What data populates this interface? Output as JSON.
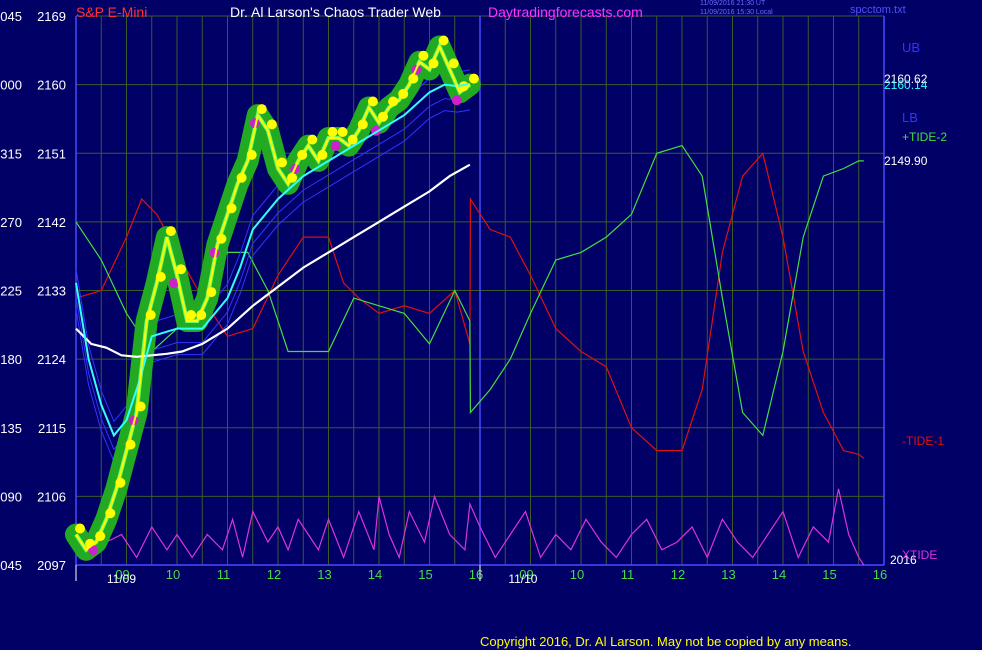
{
  "header": {
    "symbol": "S&P E-Mini",
    "title": "Dr. Al Larson's Chaos Trader Web",
    "site": "Daytradingforecasts.com",
    "stamp_utc": "11/09/2016 21:30 UT",
    "stamp_local": "11/09/2016 15:30 Local",
    "file": "spcctom.txt"
  },
  "copyright": "Copyright 2016, Dr. Al Larson. May not be copied by any means.",
  "colors": {
    "background": "#000066",
    "grid": "#3b5b2b",
    "axis": "#4a4aff",
    "symbol": "#ff3030",
    "title": "#ffffff",
    "site": "#ff33ff",
    "price_yellow": "#ffff00",
    "band_green": "#22aa22",
    "cyan": "#33ffff",
    "white": "#ffffff",
    "tide_red": "#dd1111",
    "tide_green": "#44dd44",
    "xtide": "#dd33dd",
    "blue_band": "#3333ff"
  },
  "chart_data": {
    "type": "line",
    "ylim": [
      2097,
      2169
    ],
    "y_ticks_price": [
      2097,
      2106,
      2115,
      2124,
      2133,
      2142,
      2151,
      2160,
      2169
    ],
    "y_ticks_left": [
      "045",
      "090",
      "135",
      "180",
      "225",
      "270",
      "315",
      "000",
      "045"
    ],
    "x_hour_labels": [
      "09",
      "10",
      "11",
      "12",
      "13",
      "14",
      "15",
      "16",
      "09",
      "10",
      "11",
      "12",
      "13",
      "14",
      "15",
      "16"
    ],
    "x_date_labels": [
      "11/09",
      "11/10"
    ],
    "year_label": "2016",
    "right_labels": {
      "ub": "UB",
      "lb": "LB",
      "price1": "2160.62",
      "price2": "2160.14",
      "tide2": "+TIDE-2",
      "tide2_value": "2149.90",
      "tide1": "-TIDE-1",
      "xtide": "XTIDE"
    },
    "series": [
      {
        "kind": "price",
        "x": [
          0,
          0.2,
          0.4,
          0.6,
          0.8,
          1.0,
          1.2,
          1.4,
          1.6,
          1.8,
          2.0,
          2.2,
          2.4,
          2.6,
          2.8,
          3.0,
          3.2,
          3.4,
          3.6,
          3.8,
          4.0,
          4.2,
          4.4,
          4.6,
          4.8,
          5.0,
          5.2,
          5.4,
          5.6,
          5.8,
          6.0,
          6.2,
          6.4,
          6.6,
          6.8,
          7.0,
          7.2,
          7.4,
          7.6,
          7.8
        ],
        "y": [
          2101,
          2099,
          2100,
          2103,
          2107,
          2112,
          2117,
          2129,
          2134,
          2140,
          2135,
          2129,
          2129,
          2132,
          2139,
          2143,
          2147,
          2150,
          2156,
          2154,
          2149,
          2147,
          2150,
          2152,
          2150,
          2153,
          2153,
          2152,
          2154,
          2157,
          2155,
          2157,
          2158,
          2160,
          2163,
          2162,
          2165,
          2162,
          2159,
          2160
        ]
      },
      {
        "kind": "cyan",
        "x": [
          0,
          0.25,
          0.5,
          0.75,
          1.0,
          1.25,
          1.5,
          2.0,
          2.5,
          3.0,
          3.25,
          3.5,
          4.0,
          4.5,
          5.0,
          5.5,
          6.0,
          6.5,
          7.0,
          7.3,
          7.55,
          7.8
        ],
        "y": [
          2134,
          2124,
          2118,
          2114,
          2116,
          2121,
          2127,
          2128,
          2128,
          2132,
          2136,
          2141,
          2145,
          2148,
          2150,
          2152,
          2154,
          2156,
          2159,
          2160,
          2159.8,
          2160.1
        ]
      },
      {
        "kind": "white",
        "x": [
          0,
          0.3,
          0.6,
          0.9,
          1.2,
          1.5,
          1.8,
          2.1,
          2.5,
          3.0,
          3.5,
          4.0,
          4.5,
          5.0,
          5.5,
          6.0,
          6.5,
          7.0,
          7.4,
          7.8
        ],
        "y": [
          2128,
          2126,
          2125.5,
          2124.5,
          2124.3,
          2124.5,
          2124.7,
          2125,
          2126,
          2128,
          2131,
          2133.5,
          2136,
          2138,
          2140,
          2142,
          2144,
          2146,
          2148,
          2149.5
        ]
      },
      {
        "kind": "tide1_red",
        "x": [
          0,
          0.5,
          1.0,
          1.3,
          1.6,
          2.0,
          2.5,
          3.0,
          3.5,
          4.0,
          4.5,
          5.0,
          5.3,
          5.6,
          6.0,
          6.5,
          7.0,
          7.5,
          7.8,
          7.81,
          8.2,
          8.6,
          9.0,
          9.5,
          10.0,
          10.5,
          11.0,
          11.5,
          12.0,
          12.4,
          12.8,
          13.2,
          13.6,
          14.0,
          14.4,
          14.8,
          15.2,
          15.5,
          15.6
        ],
        "y": [
          2132,
          2133,
          2140,
          2145,
          2143,
          2138,
          2132,
          2127,
          2128,
          2135,
          2140,
          2140,
          2134,
          2132,
          2130,
          2131,
          2130,
          2133,
          2126,
          2145,
          2141,
          2140,
          2135,
          2128,
          2125,
          2123,
          2115,
          2112,
          2112,
          2120,
          2138,
          2148,
          2151,
          2140,
          2125,
          2117,
          2112,
          2111.5,
          2111
        ]
      },
      {
        "kind": "tide2_green",
        "x": [
          0,
          0.5,
          1.0,
          1.5,
          2.0,
          2.5,
          3.0,
          3.4,
          3.8,
          4.2,
          4.6,
          5.0,
          5.5,
          6.0,
          6.5,
          7.0,
          7.5,
          7.8,
          7.81,
          8.2,
          8.6,
          9.0,
          9.5,
          10.0,
          10.5,
          11.0,
          11.5,
          12.0,
          12.4,
          12.8,
          13.2,
          13.6,
          14.0,
          14.4,
          14.8,
          15.2,
          15.5,
          15.6
        ],
        "y": [
          2142,
          2137,
          2130,
          2125,
          2128,
          2133,
          2138,
          2138,
          2133,
          2125,
          2125,
          2125,
          2132,
          2131,
          2130,
          2126,
          2133,
          2129,
          2117,
          2120,
          2124,
          2130,
          2137,
          2138,
          2140,
          2143,
          2151,
          2152,
          2148,
          2132,
          2117,
          2114,
          2125,
          2140,
          2148,
          2149,
          2150,
          2150
        ]
      },
      {
        "kind": "xtide",
        "x": [
          0,
          0.3,
          0.6,
          0.9,
          1.2,
          1.5,
          1.8,
          2.0,
          2.3,
          2.6,
          2.9,
          3.1,
          3.3,
          3.5,
          3.8,
          4.0,
          4.2,
          4.4,
          4.6,
          4.8,
          5.0,
          5.3,
          5.6,
          5.9,
          6.0,
          6.2,
          6.4,
          6.6,
          6.9,
          7.1,
          7.4,
          7.7,
          7.8,
          8.0,
          8.3,
          8.6,
          8.9,
          9.2,
          9.5,
          9.8,
          10.1,
          10.4,
          10.7,
          11.0,
          11.3,
          11.6,
          11.9,
          12.2,
          12.5,
          12.8,
          13.1,
          13.4,
          13.7,
          14.0,
          14.3,
          14.6,
          14.9,
          15.1,
          15.3,
          15.5,
          15.6
        ],
        "y": [
          2099,
          2098,
          2100,
          2101,
          2098,
          2102,
          2099,
          2101,
          2098,
          2101,
          2099,
          2103,
          2098,
          2104,
          2100,
          2102,
          2099,
          2103,
          2101,
          2099,
          2103,
          2098,
          2104,
          2099,
          2106,
          2101,
          2098,
          2104,
          2100,
          2106,
          2101,
          2099,
          2105,
          2102,
          2098,
          2101,
          2104,
          2098,
          2101,
          2099,
          2103,
          2100,
          2098,
          2101,
          2103,
          2099,
          2100,
          2102,
          2098,
          2103,
          2100,
          2098,
          2101,
          2104,
          2098,
          2102,
          2100,
          2107,
          2101,
          2098,
          2097
        ]
      }
    ]
  }
}
